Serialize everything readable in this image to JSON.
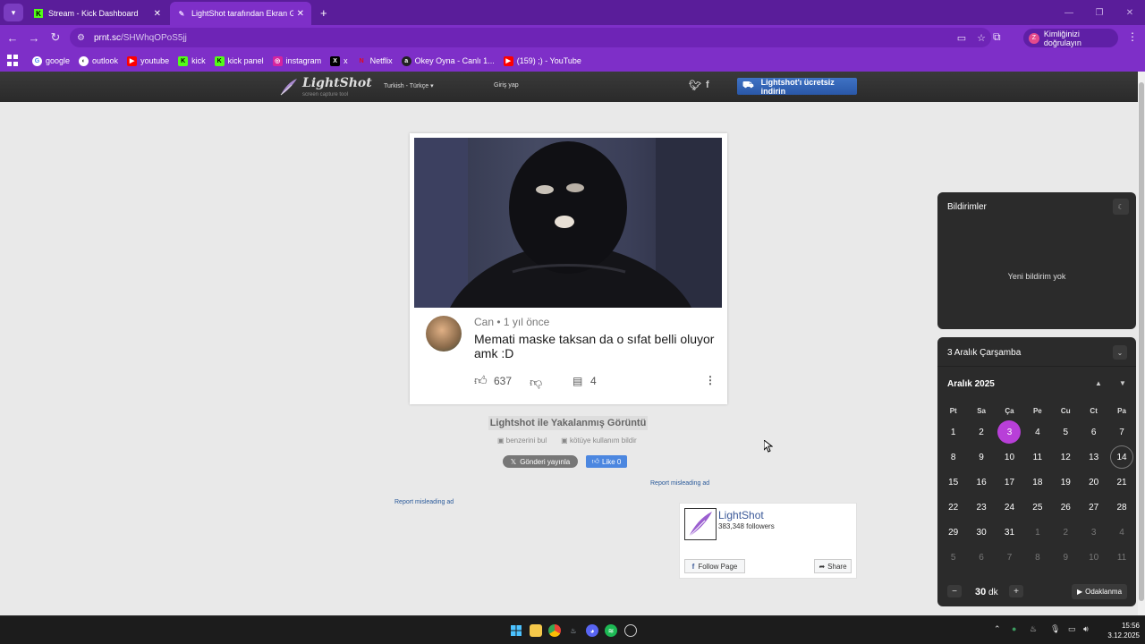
{
  "browser": {
    "tabs": [
      {
        "title": "Stream - Kick Dashboard",
        "icon": "kick-icon",
        "active": false
      },
      {
        "title": "LightShot tarafından Ekran Görü",
        "icon": "feather-icon",
        "active": true
      }
    ],
    "url_host": "prnt.sc",
    "url_path": "/SHWhqOPoS5jj",
    "profile_label": "Kimliğinizi doğrulayın",
    "profile_initial": "Z",
    "bookmarks": [
      {
        "label": "google",
        "icon": "google-icon",
        "color": "#4285f4"
      },
      {
        "label": "outlook",
        "icon": "outlook-icon",
        "color": "#0a64c8"
      },
      {
        "label": "youtube",
        "icon": "youtube-icon",
        "color": "#ff0000"
      },
      {
        "label": "kick",
        "icon": "kick-icon",
        "color": "#53fc18"
      },
      {
        "label": "kick panel",
        "icon": "kick-icon",
        "color": "#53fc18"
      },
      {
        "label": "instagram",
        "icon": "instagram-icon",
        "color": "#d6249f"
      },
      {
        "label": "x",
        "icon": "x-icon",
        "color": "#000000"
      },
      {
        "label": "Netflix",
        "icon": "netflix-icon",
        "color": "#e50914"
      },
      {
        "label": "Okey Oyna - Canlı 1...",
        "icon": "okey-icon",
        "color": "#222222"
      },
      {
        "label": "(159) ;) - YouTube",
        "icon": "youtube-icon",
        "color": "#ff0000"
      }
    ]
  },
  "lightshot": {
    "logo_name": "LightShot",
    "logo_sub": "screen capture tool",
    "language": "Turkish - Türkçe",
    "login": "Giriş yap",
    "download_button": "Lightshot'ı ücretsiz indirin",
    "comment": {
      "author_meta": "Can • 1 yıl önce",
      "text": "Memati maske taksan da o sıfat belli oluyor amk :D",
      "likes": "637",
      "replies": "4"
    },
    "caption": "Lightshot ile Yakalanmış Görüntü",
    "similar": "benzerini bul",
    "report_abuse": "kötüye kullanım bildir",
    "tweet_label": "Gönderi yayınla",
    "fb_like_label": "Like 0",
    "report_ad": "Report misleading ad",
    "fb_widget": {
      "name": "LightShot",
      "followers": "383,348 followers",
      "follow_label": "Follow Page",
      "share_label": "Share"
    }
  },
  "notifications": {
    "title": "Bildirimler",
    "empty": "Yeni bildirim yok"
  },
  "calendar": {
    "date_header": "3 Aralık Çarşamba",
    "month_label": "Aralık 2025",
    "weekdays": [
      "Pt",
      "Sa",
      "Ça",
      "Pe",
      "Cu",
      "Ct",
      "Pa"
    ],
    "days": [
      "1",
      "2",
      "3",
      "4",
      "5",
      "6",
      "7",
      "8",
      "9",
      "10",
      "11",
      "12",
      "13",
      "14",
      "15",
      "16",
      "17",
      "18",
      "19",
      "20",
      "21",
      "22",
      "23",
      "24",
      "25",
      "26",
      "27",
      "28",
      "29",
      "30",
      "31",
      "1",
      "2",
      "3",
      "4",
      "5",
      "6",
      "7",
      "8",
      "9",
      "10",
      "11"
    ],
    "today_index": 2,
    "outlined_index": 13,
    "dim_from_index": 31,
    "focus_minutes": "30",
    "focus_unit": "dk",
    "focus_label": "Odaklanma",
    "accent": "#b83fd8"
  },
  "taskbar": {
    "time": "15:56",
    "date": "3.12.2025"
  }
}
